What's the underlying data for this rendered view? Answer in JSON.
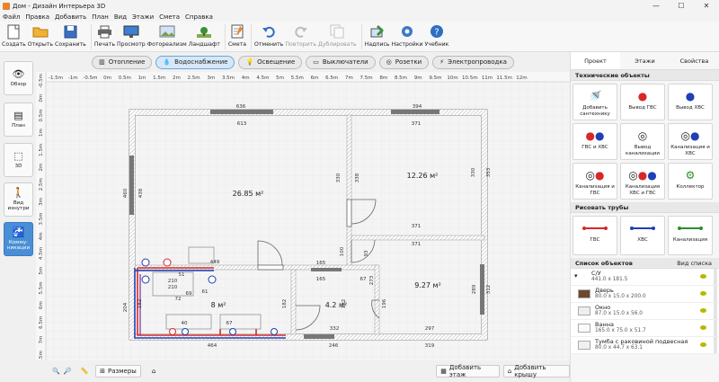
{
  "window": {
    "title": "Дом - Дизайн Интерьера 3D",
    "controls": [
      "—",
      "☐",
      "✕"
    ]
  },
  "menu": [
    "Файл",
    "Правка",
    "Добавить",
    "План",
    "Вид",
    "Этажи",
    "Смета",
    "Справка"
  ],
  "toolbar": {
    "create": "Создать",
    "open": "Открыть",
    "save": "Сохранить",
    "print": "Печать",
    "preview": "Просмотр",
    "photo": "Фотореализм",
    "landscape": "Ландшафт",
    "estimate": "Смета",
    "undo": "Отменить",
    "redo": "Повторить",
    "duplicate": "Дублировать",
    "label": "Надпись",
    "settings": "Настройки",
    "tutorial": "Учебник"
  },
  "leftbar": {
    "overview": "Обзор",
    "plan": "План",
    "view3d": "3D",
    "inside": "Вид изнутри",
    "comm": "Комму-никации"
  },
  "modes": {
    "heating": "Отопление",
    "water": "Водоснабжение",
    "lighting": "Освещение",
    "switches": "Выключатели",
    "sockets": "Розетки",
    "wiring": "Электропроводка"
  },
  "ruler": {
    "top": [
      "-1.5m",
      "-1m",
      "-0.5m",
      "0m",
      "0.5m",
      "1m",
      "1.5m",
      "2m",
      "2.5m",
      "3m",
      "3.5m",
      "4m",
      "4.5m",
      "5m",
      "5.5m",
      "6m",
      "6.5m",
      "7m",
      "7.5m",
      "8m",
      "8.5m",
      "9m",
      "9.5m",
      "10m",
      "10.5m",
      "11m",
      "11.5m",
      "12m"
    ],
    "left": [
      "-0.5m",
      "0m",
      "0.5m",
      "1m",
      "1.5m",
      "2m",
      "2.5m",
      "3m",
      "3.5m",
      "4m",
      "4.5m",
      "5m",
      "5.5m",
      "6m",
      "6.5m",
      "7m",
      "7.5m"
    ]
  },
  "plan": {
    "rooms": [
      {
        "area": "26.85 м²"
      },
      {
        "area": "12.26 м²"
      },
      {
        "area": "8 м²"
      },
      {
        "area": "4.2 м²"
      },
      {
        "area": "9.27 м²"
      }
    ],
    "dims": [
      "636",
      "394",
      "613",
      "371",
      "460",
      "438",
      "330",
      "338",
      "353",
      "330",
      "371",
      "371",
      "449",
      "100",
      "93",
      "165",
      "165",
      "67",
      "273",
      "182",
      "204",
      "182",
      "182",
      "332",
      "196",
      "289",
      "312",
      "297",
      "464",
      "246",
      "319",
      "51",
      "210",
      "210",
      "61",
      "69",
      "72",
      "40",
      "67"
    ]
  },
  "bottom": {
    "dims": "Размеры",
    "add_floor": "Добавить этаж",
    "add_roof": "Добавить крышу"
  },
  "right": {
    "tabs": [
      "Проект",
      "Этажи",
      "Свойства"
    ],
    "tech_title": "Технические объекты",
    "tech": [
      "Добавить сантехнику",
      "Вывод ГВС",
      "Вывод ХВС",
      "ГВС и ХВС",
      "Вывод канализации",
      "Канализация и ХВС",
      "Канализация и ГВС",
      "Канализация ХВС и ГВС",
      "Коллектор"
    ],
    "pipes_title": "Рисовать трубы",
    "pipes": [
      "ГВС",
      "ХВС",
      "Канализация"
    ],
    "objects_title": "Список объектов",
    "objects_view": "Вид списка",
    "objects": [
      {
        "name": "С/У",
        "size": "441.0 x 181.5"
      },
      {
        "name": "Дверь",
        "size": "80.0 x 15.0 x 200.0"
      },
      {
        "name": "Окно",
        "size": "87.0 x 15.0 x 56.0"
      },
      {
        "name": "Ванна",
        "size": "165.0 x 75.0 x 51.7"
      },
      {
        "name": "Тумба с раковиной подвесная",
        "size": "80.0 x 44.7 x 63.1"
      }
    ]
  },
  "colors": {
    "hot": "#d62828",
    "cold": "#1f3fb5",
    "sewer": "#2a8f2a",
    "accent": "#4a8fd6"
  }
}
